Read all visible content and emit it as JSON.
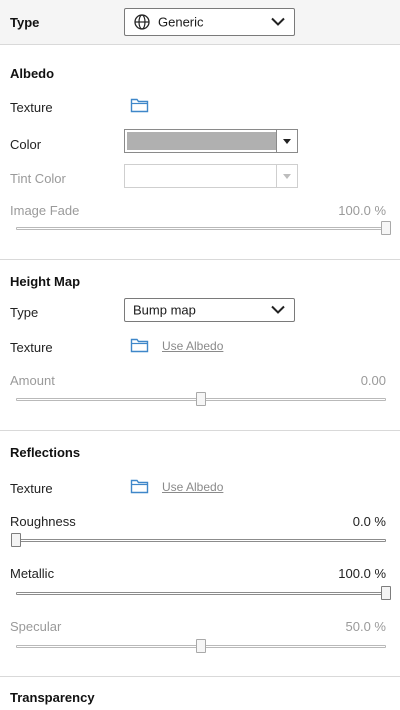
{
  "header": {
    "type_label": "Type",
    "type_value": "Generic",
    "type_icon": "globe-icon"
  },
  "albedo": {
    "title": "Albedo",
    "texture_label": "Texture",
    "color_label": "Color",
    "color_value": "#b0b0b0",
    "tint_label": "Tint Color",
    "image_fade_label": "Image Fade",
    "image_fade_value": "100.0 %",
    "image_fade_level": 1.0
  },
  "height_map": {
    "title": "Height Map",
    "type_label": "Type",
    "type_value": "Bump map",
    "texture_label": "Texture",
    "texture_link": "Use Albedo",
    "amount_label": "Amount",
    "amount_value": "0.00",
    "amount_level": 0.5
  },
  "reflections": {
    "title": "Reflections",
    "texture_label": "Texture",
    "texture_link": "Use Albedo",
    "roughness_label": "Roughness",
    "roughness_value": "0.0 %",
    "roughness_level": 0.0,
    "metallic_label": "Metallic",
    "metallic_value": "100.0 %",
    "metallic_level": 1.0,
    "specular_label": "Specular",
    "specular_value": "50.0 %",
    "specular_level": 0.5
  },
  "transparency": {
    "title": "Transparency"
  },
  "colors": {
    "folder_icon": "#3f87c9",
    "disabled_text": "#9a9a9a"
  }
}
